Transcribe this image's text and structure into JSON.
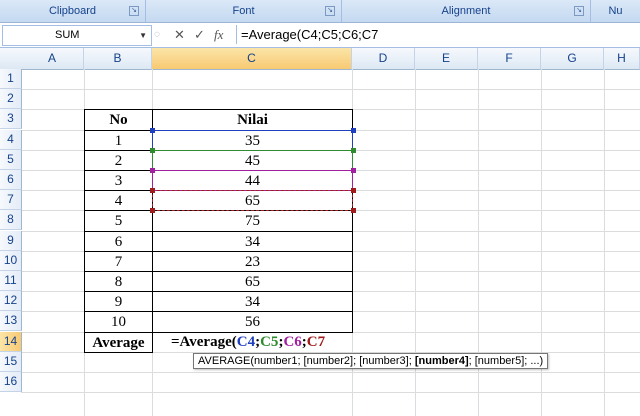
{
  "ribbon": {
    "groups": [
      "Clipboard",
      "Font",
      "Alignment",
      "Nu"
    ]
  },
  "formula_bar": {
    "name_box": "SUM",
    "cancel_icon": "✕",
    "enter_icon": "✓",
    "fx_label": "fx",
    "formula": "=Average(C4;C5;C6;C7"
  },
  "columns": [
    "A",
    "B",
    "C",
    "D",
    "E",
    "F",
    "G",
    "H"
  ],
  "rows": [
    "1",
    "2",
    "3",
    "4",
    "5",
    "6",
    "7",
    "8",
    "9",
    "10",
    "11",
    "12",
    "13",
    "14",
    "15",
    "16"
  ],
  "table": {
    "header_no": "No",
    "header_nilai": "Nilai",
    "no": [
      "1",
      "2",
      "3",
      "4",
      "5",
      "6",
      "7",
      "8",
      "9",
      "10"
    ],
    "nilai": [
      "35",
      "45",
      "44",
      "65",
      "75",
      "34",
      "23",
      "65",
      "34",
      "56"
    ],
    "average_label": "Average"
  },
  "editing_cell": {
    "prefix": "=Average(",
    "refs": [
      "C4",
      "C5",
      "C6",
      "C7"
    ],
    "separators": [
      ";",
      ";",
      ";"
    ],
    "ref_colors": [
      "#1f3fbf",
      "#2e8b2e",
      "#a020a0",
      "#a01c1c"
    ]
  },
  "tooltip": {
    "before": "AVERAGE(number1; [number2]; [number3]; ",
    "bold": "[number4]",
    "after": "; [number5]; ...)"
  }
}
